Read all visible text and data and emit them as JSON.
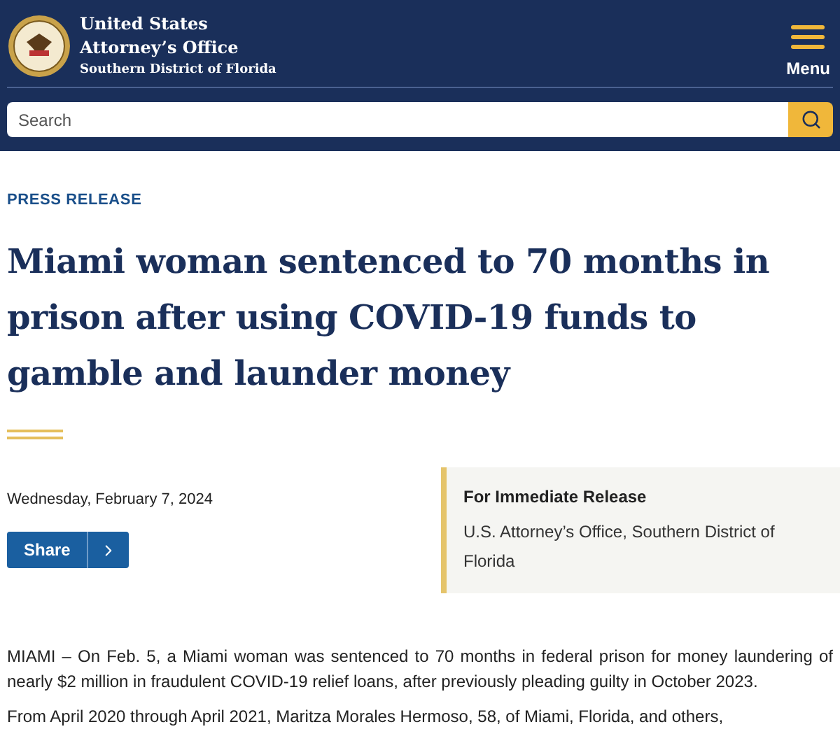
{
  "header": {
    "agency_line_1": "United States",
    "agency_line_2": "Attorney’s Office",
    "district": "Southern District of Florida",
    "menu_label": "Menu"
  },
  "search": {
    "placeholder": "Search"
  },
  "article": {
    "eyebrow": "PRESS RELEASE",
    "headline": "Miami woman sentenced to 70 months in prison after using COVID-19 funds to gamble and launder money",
    "date": "Wednesday, February 7, 2024",
    "share_label": "Share"
  },
  "release_box": {
    "title": "For Immediate Release",
    "office": "U.S. Attorney’s Office, Southern District of Florida"
  },
  "paragraphs": [
    "MIAMI – On Feb. 5, a Miami woman was sentenced to 70 months in federal prison for money laundering of nearly $2 million in fraudulent COVID-19 relief loans, after previously pleading guilty in October 2023.",
    "From April 2020 through April 2021, Maritza Morales Hermoso, 58, of Miami, Florida, and others,"
  ]
}
